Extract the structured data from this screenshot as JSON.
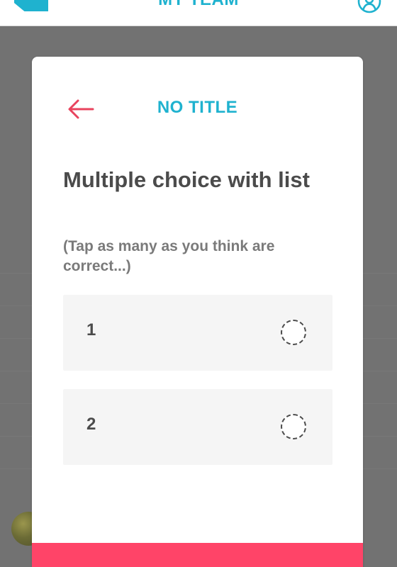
{
  "topbar": {
    "title": "MY TEAM",
    "icons": {
      "logo": "logo-shape",
      "account": "account-icon"
    },
    "accent_color": "#1fb2cf"
  },
  "modal": {
    "title": "NO TITLE",
    "back_icon": "arrow-left-icon",
    "question": "Multiple choice with list",
    "hint": "(Tap as many as you think are correct...)",
    "choices": [
      {
        "label": "1",
        "selected": false
      },
      {
        "label": "2",
        "selected": false
      }
    ],
    "colors": {
      "title": "#1fb2cf",
      "back_arrow": "#e8435d",
      "submit": "#ff4468",
      "choice_bg": "#f5f5f5"
    }
  }
}
